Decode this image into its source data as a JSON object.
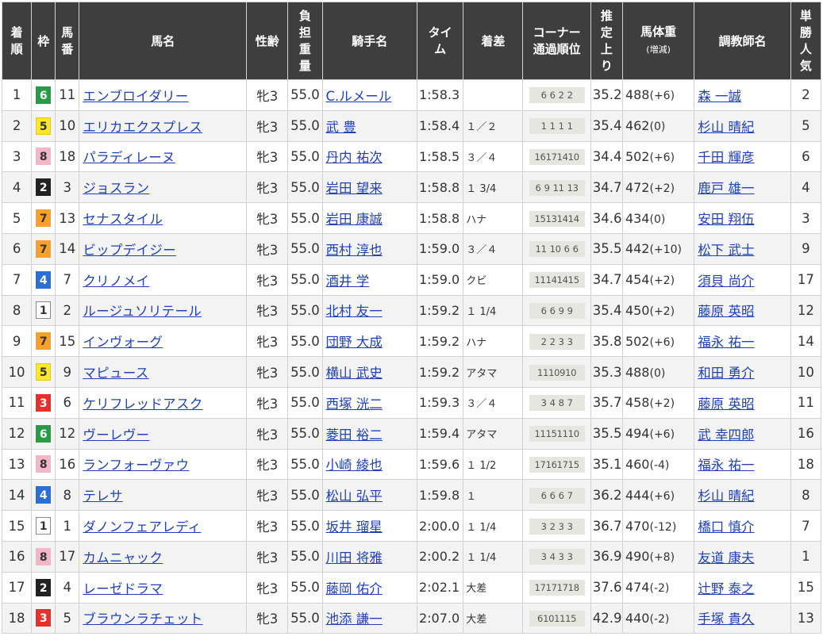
{
  "headers": {
    "rank": [
      "着",
      "順"
    ],
    "waku": [
      "枠"
    ],
    "number": [
      "馬",
      "番"
    ],
    "horse": "馬名",
    "sexage": "性齢",
    "weight": [
      "負",
      "担",
      "重",
      "量"
    ],
    "jockey": "騎手名",
    "time": [
      "タイ",
      "ム"
    ],
    "margin": "着差",
    "corner": [
      "コーナー",
      "通過順位"
    ],
    "last3f": [
      "推",
      "定",
      "上",
      "り"
    ],
    "body": "馬体重",
    "body_sub": "(増減)",
    "trainer": "調教師名",
    "pop": [
      "単",
      "勝",
      "人",
      "気"
    ]
  },
  "waku_colors": {
    "1": {
      "bg": "#ffffff",
      "fg": "#333333",
      "border": "#888888"
    },
    "2": {
      "bg": "#222222",
      "fg": "#ffffff",
      "border": "#222222"
    },
    "3": {
      "bg": "#e8302b",
      "fg": "#ffffff",
      "border": "#e8302b"
    },
    "4": {
      "bg": "#2a6fd6",
      "fg": "#ffffff",
      "border": "#2a6fd6"
    },
    "5": {
      "bg": "#ffe627",
      "fg": "#333333",
      "border": "#e8cc00"
    },
    "6": {
      "bg": "#279b46",
      "fg": "#ffffff",
      "border": "#279b46"
    },
    "7": {
      "bg": "#f7a12a",
      "fg": "#333333",
      "border": "#f7a12a"
    },
    "8": {
      "bg": "#f6b4c8",
      "fg": "#333333",
      "border": "#f6b4c8"
    }
  },
  "rows": [
    {
      "rank": "1",
      "waku": "6",
      "num": "11",
      "horse": "エンブロイダリー",
      "sexage": "牝3",
      "kg": "55.0",
      "jockey": "C.ルメール",
      "time": "1:58.3",
      "margin": "",
      "corner": [
        "6",
        "6",
        "2",
        "2"
      ],
      "last3f": "35.2",
      "bw": "488",
      "bwchg": "(+6)",
      "trainer": "森 一誠",
      "pop": "2"
    },
    {
      "rank": "2",
      "waku": "5",
      "num": "10",
      "horse": "エリカエクスプレス",
      "sexage": "牝3",
      "kg": "55.0",
      "jockey": "武 豊",
      "time": "1:58.4",
      "margin": "１／２",
      "corner": [
        "1",
        "1",
        "1",
        "1"
      ],
      "last3f": "35.4",
      "bw": "462",
      "bwchg": "(0)",
      "trainer": "杉山 晴紀",
      "pop": "5"
    },
    {
      "rank": "3",
      "waku": "8",
      "num": "18",
      "horse": "パラディレーヌ",
      "sexage": "牝3",
      "kg": "55.0",
      "jockey": "丹内 祐次",
      "time": "1:58.5",
      "margin": "３／４",
      "corner": [
        "16",
        "17",
        "14",
        "10"
      ],
      "last3f": "34.4",
      "bw": "502",
      "bwchg": "(+6)",
      "trainer": "千田 輝彦",
      "pop": "6"
    },
    {
      "rank": "4",
      "waku": "2",
      "num": "3",
      "horse": "ジョスラン",
      "sexage": "牝3",
      "kg": "55.0",
      "jockey": "岩田 望来",
      "time": "1:58.8",
      "margin": "１ 3/4",
      "corner": [
        "6",
        "9",
        "11",
        "13"
      ],
      "last3f": "34.7",
      "bw": "472",
      "bwchg": "(+2)",
      "trainer": "鹿戸 雄一",
      "pop": "4"
    },
    {
      "rank": "5",
      "waku": "7",
      "num": "13",
      "horse": "セナスタイル",
      "sexage": "牝3",
      "kg": "55.0",
      "jockey": "岩田 康誠",
      "time": "1:58.8",
      "margin": "ハナ",
      "corner": [
        "15",
        "13",
        "14",
        "14"
      ],
      "last3f": "34.6",
      "bw": "434",
      "bwchg": "(0)",
      "trainer": "安田 翔伍",
      "pop": "3"
    },
    {
      "rank": "6",
      "waku": "7",
      "num": "14",
      "horse": "ビップデイジー",
      "sexage": "牝3",
      "kg": "55.0",
      "jockey": "西村 淳也",
      "time": "1:59.0",
      "margin": "３／４",
      "corner": [
        "11",
        "10",
        "6",
        "6"
      ],
      "last3f": "35.5",
      "bw": "442",
      "bwchg": "(+10)",
      "trainer": "松下 武士",
      "pop": "9"
    },
    {
      "rank": "7",
      "waku": "4",
      "num": "7",
      "horse": "クリノメイ",
      "sexage": "牝3",
      "kg": "55.0",
      "jockey": "酒井 学",
      "time": "1:59.0",
      "margin": "クビ",
      "corner": [
        "11",
        "14",
        "14",
        "15"
      ],
      "last3f": "34.7",
      "bw": "454",
      "bwchg": "(+2)",
      "trainer": "須貝 尚介",
      "pop": "17"
    },
    {
      "rank": "8",
      "waku": "1",
      "num": "2",
      "horse": "ルージュソリテール",
      "sexage": "牝3",
      "kg": "55.0",
      "jockey": "北村 友一",
      "time": "1:59.2",
      "margin": "１ 1/4",
      "corner": [
        "6",
        "6",
        "9",
        "9"
      ],
      "last3f": "35.4",
      "bw": "450",
      "bwchg": "(+2)",
      "trainer": "藤原 英昭",
      "pop": "12"
    },
    {
      "rank": "9",
      "waku": "7",
      "num": "15",
      "horse": "インヴォーグ",
      "sexage": "牝3",
      "kg": "55.0",
      "jockey": "団野 大成",
      "time": "1:59.2",
      "margin": "ハナ",
      "corner": [
        "2",
        "2",
        "3",
        "3"
      ],
      "last3f": "35.8",
      "bw": "502",
      "bwchg": "(+6)",
      "trainer": "福永 祐一",
      "pop": "14"
    },
    {
      "rank": "10",
      "waku": "5",
      "num": "9",
      "horse": "マピュース",
      "sexage": "牝3",
      "kg": "55.0",
      "jockey": "横山 武史",
      "time": "1:59.2",
      "margin": "アタマ",
      "corner": [
        "11",
        "10",
        "9",
        "10"
      ],
      "last3f": "35.3",
      "bw": "488",
      "bwchg": "(0)",
      "trainer": "和田 勇介",
      "pop": "10"
    },
    {
      "rank": "11",
      "waku": "3",
      "num": "6",
      "horse": "ケリフレッドアスク",
      "sexage": "牝3",
      "kg": "55.0",
      "jockey": "西塚 洸二",
      "time": "1:59.3",
      "margin": "３／４",
      "corner": [
        "3",
        "4",
        "8",
        "7"
      ],
      "last3f": "35.7",
      "bw": "458",
      "bwchg": "(+2)",
      "trainer": "藤原 英昭",
      "pop": "11"
    },
    {
      "rank": "12",
      "waku": "6",
      "num": "12",
      "horse": "ヴーレヴー",
      "sexage": "牝3",
      "kg": "55.0",
      "jockey": "菱田 裕二",
      "time": "1:59.4",
      "margin": "アタマ",
      "corner": [
        "11",
        "15",
        "11",
        "10"
      ],
      "last3f": "35.5",
      "bw": "494",
      "bwchg": "(+6)",
      "trainer": "武 幸四郎",
      "pop": "16"
    },
    {
      "rank": "13",
      "waku": "8",
      "num": "16",
      "horse": "ランフォーヴァウ",
      "sexage": "牝3",
      "kg": "55.0",
      "jockey": "小崎 綾也",
      "time": "1:59.6",
      "margin": "１ 1/2",
      "corner": [
        "17",
        "16",
        "17",
        "15"
      ],
      "last3f": "35.1",
      "bw": "460",
      "bwchg": "(-4)",
      "trainer": "福永 祐一",
      "pop": "18"
    },
    {
      "rank": "14",
      "waku": "4",
      "num": "8",
      "horse": "テレサ",
      "sexage": "牝3",
      "kg": "55.0",
      "jockey": "松山 弘平",
      "time": "1:59.8",
      "margin": "１",
      "corner": [
        "6",
        "6",
        "6",
        "7"
      ],
      "last3f": "36.2",
      "bw": "444",
      "bwchg": "(+6)",
      "trainer": "杉山 晴紀",
      "pop": "8"
    },
    {
      "rank": "15",
      "waku": "1",
      "num": "1",
      "horse": "ダノンフェアレディ",
      "sexage": "牝3",
      "kg": "55.0",
      "jockey": "坂井 瑠星",
      "time": "2:00.0",
      "margin": "１ 1/4",
      "corner": [
        "3",
        "2",
        "3",
        "3"
      ],
      "last3f": "36.7",
      "bw": "470",
      "bwchg": "(-12)",
      "trainer": "橋口 慎介",
      "pop": "7"
    },
    {
      "rank": "16",
      "waku": "8",
      "num": "17",
      "horse": "カムニャック",
      "sexage": "牝3",
      "kg": "55.0",
      "jockey": "川田 将雅",
      "time": "2:00.2",
      "margin": "１ 1/4",
      "corner": [
        "3",
        "4",
        "3",
        "3"
      ],
      "last3f": "36.9",
      "bw": "490",
      "bwchg": "(+8)",
      "trainer": "友道 康夫",
      "pop": "1"
    },
    {
      "rank": "17",
      "waku": "2",
      "num": "4",
      "horse": "レーゼドラマ",
      "sexage": "牝3",
      "kg": "55.0",
      "jockey": "藤岡 佑介",
      "time": "2:02.1",
      "margin": "大差",
      "corner": [
        "17",
        "17",
        "17",
        "18"
      ],
      "last3f": "37.6",
      "bw": "474",
      "bwchg": "(-2)",
      "trainer": "辻野 泰之",
      "pop": "15"
    },
    {
      "rank": "18",
      "waku": "3",
      "num": "5",
      "horse": "ブラウンラチェット",
      "sexage": "牝3",
      "kg": "55.0",
      "jockey": "池添 謙一",
      "time": "2:07.0",
      "margin": "大差",
      "corner": [
        "6",
        "10",
        "11",
        "15"
      ],
      "last3f": "42.9",
      "bw": "440",
      "bwchg": "(-2)",
      "trainer": "手塚 貴久",
      "pop": "13"
    }
  ]
}
